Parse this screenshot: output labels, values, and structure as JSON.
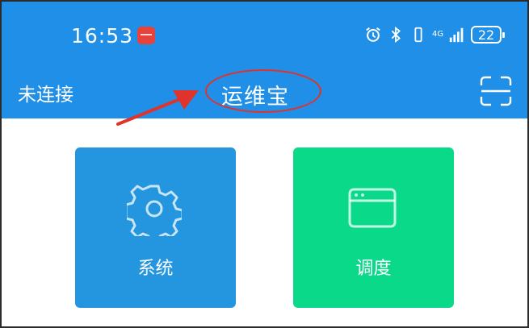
{
  "status_bar": {
    "time": "16:53",
    "network": "4G",
    "battery": "22"
  },
  "header": {
    "connection_status": "未连接",
    "title": "运维宝"
  },
  "tiles": [
    {
      "label": "系统",
      "icon": "gear-icon",
      "color": "#2496e0"
    },
    {
      "label": "调度",
      "icon": "browser-window-icon",
      "color": "#0ad98a"
    }
  ],
  "colors": {
    "header_bg": "#1f8fe8",
    "annotation_red": "#e0332c"
  }
}
